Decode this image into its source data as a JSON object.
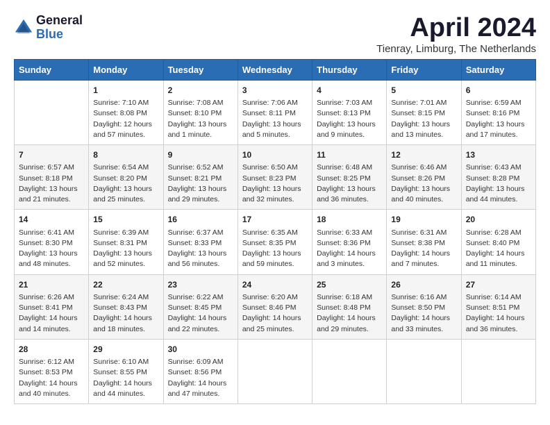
{
  "logo": {
    "general": "General",
    "blue": "Blue"
  },
  "title": "April 2024",
  "subtitle": "Tienray, Limburg, The Netherlands",
  "weekdays": [
    "Sunday",
    "Monday",
    "Tuesday",
    "Wednesday",
    "Thursday",
    "Friday",
    "Saturday"
  ],
  "weeks": [
    [
      {
        "day": "",
        "info": ""
      },
      {
        "day": "1",
        "info": "Sunrise: 7:10 AM\nSunset: 8:08 PM\nDaylight: 12 hours\nand 57 minutes."
      },
      {
        "day": "2",
        "info": "Sunrise: 7:08 AM\nSunset: 8:10 PM\nDaylight: 13 hours\nand 1 minute."
      },
      {
        "day": "3",
        "info": "Sunrise: 7:06 AM\nSunset: 8:11 PM\nDaylight: 13 hours\nand 5 minutes."
      },
      {
        "day": "4",
        "info": "Sunrise: 7:03 AM\nSunset: 8:13 PM\nDaylight: 13 hours\nand 9 minutes."
      },
      {
        "day": "5",
        "info": "Sunrise: 7:01 AM\nSunset: 8:15 PM\nDaylight: 13 hours\nand 13 minutes."
      },
      {
        "day": "6",
        "info": "Sunrise: 6:59 AM\nSunset: 8:16 PM\nDaylight: 13 hours\nand 17 minutes."
      }
    ],
    [
      {
        "day": "7",
        "info": "Sunrise: 6:57 AM\nSunset: 8:18 PM\nDaylight: 13 hours\nand 21 minutes."
      },
      {
        "day": "8",
        "info": "Sunrise: 6:54 AM\nSunset: 8:20 PM\nDaylight: 13 hours\nand 25 minutes."
      },
      {
        "day": "9",
        "info": "Sunrise: 6:52 AM\nSunset: 8:21 PM\nDaylight: 13 hours\nand 29 minutes."
      },
      {
        "day": "10",
        "info": "Sunrise: 6:50 AM\nSunset: 8:23 PM\nDaylight: 13 hours\nand 32 minutes."
      },
      {
        "day": "11",
        "info": "Sunrise: 6:48 AM\nSunset: 8:25 PM\nDaylight: 13 hours\nand 36 minutes."
      },
      {
        "day": "12",
        "info": "Sunrise: 6:46 AM\nSunset: 8:26 PM\nDaylight: 13 hours\nand 40 minutes."
      },
      {
        "day": "13",
        "info": "Sunrise: 6:43 AM\nSunset: 8:28 PM\nDaylight: 13 hours\nand 44 minutes."
      }
    ],
    [
      {
        "day": "14",
        "info": "Sunrise: 6:41 AM\nSunset: 8:30 PM\nDaylight: 13 hours\nand 48 minutes."
      },
      {
        "day": "15",
        "info": "Sunrise: 6:39 AM\nSunset: 8:31 PM\nDaylight: 13 hours\nand 52 minutes."
      },
      {
        "day": "16",
        "info": "Sunrise: 6:37 AM\nSunset: 8:33 PM\nDaylight: 13 hours\nand 56 minutes."
      },
      {
        "day": "17",
        "info": "Sunrise: 6:35 AM\nSunset: 8:35 PM\nDaylight: 13 hours\nand 59 minutes."
      },
      {
        "day": "18",
        "info": "Sunrise: 6:33 AM\nSunset: 8:36 PM\nDaylight: 14 hours\nand 3 minutes."
      },
      {
        "day": "19",
        "info": "Sunrise: 6:31 AM\nSunset: 8:38 PM\nDaylight: 14 hours\nand 7 minutes."
      },
      {
        "day": "20",
        "info": "Sunrise: 6:28 AM\nSunset: 8:40 PM\nDaylight: 14 hours\nand 11 minutes."
      }
    ],
    [
      {
        "day": "21",
        "info": "Sunrise: 6:26 AM\nSunset: 8:41 PM\nDaylight: 14 hours\nand 14 minutes."
      },
      {
        "day": "22",
        "info": "Sunrise: 6:24 AM\nSunset: 8:43 PM\nDaylight: 14 hours\nand 18 minutes."
      },
      {
        "day": "23",
        "info": "Sunrise: 6:22 AM\nSunset: 8:45 PM\nDaylight: 14 hours\nand 22 minutes."
      },
      {
        "day": "24",
        "info": "Sunrise: 6:20 AM\nSunset: 8:46 PM\nDaylight: 14 hours\nand 25 minutes."
      },
      {
        "day": "25",
        "info": "Sunrise: 6:18 AM\nSunset: 8:48 PM\nDaylight: 14 hours\nand 29 minutes."
      },
      {
        "day": "26",
        "info": "Sunrise: 6:16 AM\nSunset: 8:50 PM\nDaylight: 14 hours\nand 33 minutes."
      },
      {
        "day": "27",
        "info": "Sunrise: 6:14 AM\nSunset: 8:51 PM\nDaylight: 14 hours\nand 36 minutes."
      }
    ],
    [
      {
        "day": "28",
        "info": "Sunrise: 6:12 AM\nSunset: 8:53 PM\nDaylight: 14 hours\nand 40 minutes."
      },
      {
        "day": "29",
        "info": "Sunrise: 6:10 AM\nSunset: 8:55 PM\nDaylight: 14 hours\nand 44 minutes."
      },
      {
        "day": "30",
        "info": "Sunrise: 6:09 AM\nSunset: 8:56 PM\nDaylight: 14 hours\nand 47 minutes."
      },
      {
        "day": "",
        "info": ""
      },
      {
        "day": "",
        "info": ""
      },
      {
        "day": "",
        "info": ""
      },
      {
        "day": "",
        "info": ""
      }
    ]
  ]
}
